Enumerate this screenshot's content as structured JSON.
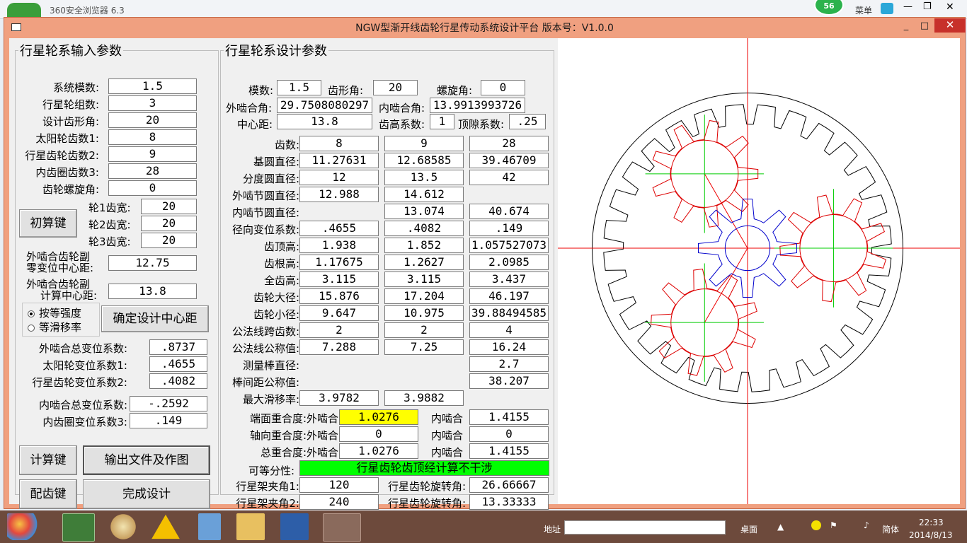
{
  "browser": {
    "title": "360安全浏览器 6.3",
    "badge": "56",
    "menu": "菜单"
  },
  "window": {
    "title": "NGW型渐开线齿轮行星传动系统设计平台  版本号：V1.0.0",
    "min": "_",
    "max": "□",
    "close": "✕"
  },
  "input_panel": {
    "legend": "行星轮系输入参数",
    "rows": [
      {
        "label": "系统模数:",
        "value": "1.5"
      },
      {
        "label": "行星轮组数:",
        "value": "3"
      },
      {
        "label": "设计齿形角:",
        "value": "20"
      },
      {
        "label": "太阳轮齿数1:",
        "value": "8"
      },
      {
        "label": "行星齿轮齿数2:",
        "value": "9"
      },
      {
        "label": "内齿圈齿数3:",
        "value": "28"
      },
      {
        "label": "齿轮螺旋角:",
        "value": "0"
      }
    ],
    "init_button": "初算键",
    "widths": [
      {
        "label": "轮1齿宽:",
        "value": "20"
      },
      {
        "label": "轮2齿宽:",
        "value": "20"
      },
      {
        "label": "轮3齿宽:",
        "value": "20"
      }
    ],
    "zero_center_label1": "外啮合齿轮副",
    "zero_center_label2": "零变位中心距:",
    "zero_center_value": "12.75",
    "calc_center_label1": "外啮合齿轮副",
    "calc_center_label2": "计算中心距:",
    "calc_center_value": "13.8",
    "radio_strength": "按等强度",
    "radio_slip": "等滑移率",
    "confirm_button": "确定设计中心距",
    "shift_rows": [
      {
        "label": "外啮合总变位系数:",
        "value": ".8737"
      },
      {
        "label": "太阳轮变位系数1:",
        "value": ".4655"
      },
      {
        "label": "行星齿轮变位系数2:",
        "value": ".4082"
      }
    ],
    "inner_rows": [
      {
        "label": "内啮合总变位系数:",
        "value": "-.2592"
      },
      {
        "label": "内齿圈变位系数3:",
        "value": ".149"
      }
    ],
    "calc_button": "计算键",
    "export_button": "输出文件及作图",
    "match_button": "配齿键",
    "finish_button": "完成设计"
  },
  "design_panel": {
    "legend": "行星轮系设计参数",
    "module_label": "模数:",
    "module": "1.5",
    "pressure_label": "齿形角:",
    "pressure": "20",
    "helix_label": "螺旋角:",
    "helix": "0",
    "ext_angle_label": "外啮合角:",
    "ext_angle": "29.7508080297",
    "int_angle_label": "内啮合角:",
    "int_angle": "13.9913993726",
    "center_label": "中心距:",
    "center": "13.8",
    "addendum_coef_label": "齿高系数:",
    "addendum_coef": "1",
    "clearance_label": "顶隙系数:",
    "clearance": ".25",
    "table": [
      {
        "label": "齿数:",
        "v1": "8",
        "v2": "9",
        "v3": "28"
      },
      {
        "label": "基圆直径:",
        "v1": "11.27631",
        "v2": "12.68585",
        "v3": "39.46709"
      },
      {
        "label": "分度圆直径:",
        "v1": "12",
        "v2": "13.5",
        "v3": "42"
      },
      {
        "label": "外啮节圆直径:",
        "v1": "12.988",
        "v2": "14.612",
        "v3": ""
      },
      {
        "label": "内啮节圆直径:",
        "v1": "",
        "v2": "13.074",
        "v3": "40.674"
      },
      {
        "label": "径向变位系数:",
        "v1": ".4655",
        "v2": ".4082",
        "v3": ".149"
      },
      {
        "label": "齿顶高:",
        "v1": "1.938",
        "v2": "1.852",
        "v3": "1.057527073"
      },
      {
        "label": "齿根高:",
        "v1": "1.17675",
        "v2": "1.2627",
        "v3": "2.0985"
      },
      {
        "label": "全齿高:",
        "v1": "3.115",
        "v2": "3.115",
        "v3": "3.437"
      },
      {
        "label": "齿轮大径:",
        "v1": "15.876",
        "v2": "17.204",
        "v3": "46.197"
      },
      {
        "label": "齿轮小径:",
        "v1": "9.647",
        "v2": "10.975",
        "v3": "39.88494585"
      },
      {
        "label": "公法线跨齿数:",
        "v1": "2",
        "v2": "2",
        "v3": "4"
      },
      {
        "label": "公法线公称值:",
        "v1": "7.288",
        "v2": "7.25",
        "v3": "16.24"
      },
      {
        "label": "测量棒直径:",
        "v1": "",
        "v2": "",
        "v3": "2.7"
      },
      {
        "label": "棒间距公称值:",
        "v1": "",
        "v2": "",
        "v3": "38.207"
      },
      {
        "label": "最大滑移率:",
        "v1": "3.9782",
        "v2": "3.9882",
        "v3": ""
      }
    ],
    "contact": [
      {
        "label": "端面重合度:外啮合",
        "ext": "1.0276",
        "int_label": "内啮合",
        "int": "1.4155"
      },
      {
        "label": "轴向重合度:外啮合",
        "ext": "0",
        "int_label": "内啮合",
        "int": "0"
      },
      {
        "label": "总重合度:外啮合",
        "ext": "1.0276",
        "int_label": "内啮合",
        "int": "1.4155"
      }
    ],
    "assembly_label": "可等分性:",
    "assembly_status": "行星齿轮齿顶经计算不干涉",
    "carrier": [
      {
        "label": "行星架夹角1:",
        "value": "120",
        "rot_label": "行星齿轮旋转角:",
        "rot": "26.66667"
      },
      {
        "label": "行星架夹角2:",
        "value": "240",
        "rot_label": "行星齿轮旋转角:",
        "rot": "13.33333"
      }
    ],
    "highlight_color": "#ffff00",
    "status_color": "#00ff00"
  },
  "taskbar": {
    "address_label": "地址",
    "desktop_label": "桌面",
    "ime_label": "简体",
    "time": "22:33",
    "date": "2014/8/13"
  }
}
